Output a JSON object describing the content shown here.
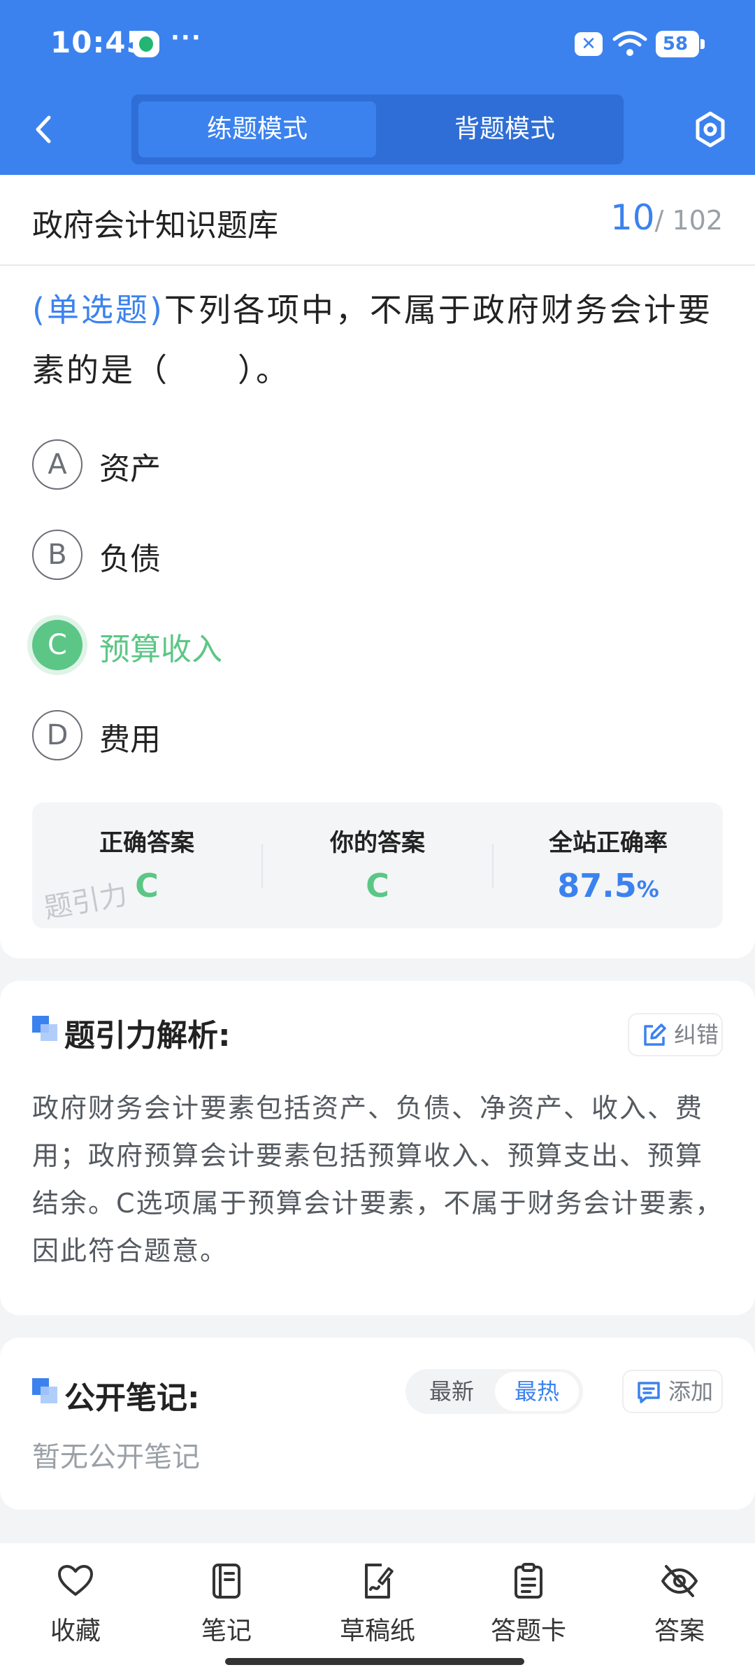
{
  "status_bar": {
    "time": "10:45",
    "dots": "···",
    "battery": "58"
  },
  "header": {
    "tabs": [
      {
        "label": "练题模式",
        "active": true
      },
      {
        "label": "背题模式",
        "active": false
      }
    ]
  },
  "question_card": {
    "bank_title": "政府会计知识题库",
    "current": "10",
    "total": "/ 102",
    "question_type": "(单选题)",
    "question_text": "下列各项中，不属于政府财务会计要素的是（　　）。",
    "options": [
      {
        "letter": "A",
        "text": "资产",
        "state": "normal"
      },
      {
        "letter": "B",
        "text": "负债",
        "state": "normal"
      },
      {
        "letter": "C",
        "text": "预算收入",
        "state": "correct"
      },
      {
        "letter": "D",
        "text": "费用",
        "state": "normal"
      }
    ],
    "result": {
      "correct_label": "正确答案",
      "correct_value": "C",
      "yours_label": "你的答案",
      "yours_value": "C",
      "rate_label": "全站正确率",
      "rate_value": "87.5",
      "rate_unit": "%"
    },
    "watermark": "题引力"
  },
  "analysis": {
    "title": "题引力解析:",
    "report_label": "纠错",
    "text": "政府财务会计要素包括资产、负债、净资产、收入、费用；政府预算会计要素包括预算收入、预算支出、预算结余。C选项属于预算会计要素，不属于财务会计要素，因此符合题意。"
  },
  "notes": {
    "title": "公开笔记:",
    "sort_latest": "最新",
    "sort_hot": "最热",
    "sort_selected": "最热",
    "add_label": "添加",
    "empty_text": "暂无公开笔记"
  },
  "bottom_nav": [
    {
      "label": "收藏",
      "icon": "heart-icon"
    },
    {
      "label": "笔记",
      "icon": "notebook-icon"
    },
    {
      "label": "草稿纸",
      "icon": "draft-paper-icon"
    },
    {
      "label": "答题卡",
      "icon": "answer-card-icon"
    },
    {
      "label": "答案",
      "icon": "eye-off-icon"
    }
  ],
  "colors": {
    "primary": "#3b82ef",
    "correct": "#5cc686",
    "background": "#f3f4f6"
  }
}
